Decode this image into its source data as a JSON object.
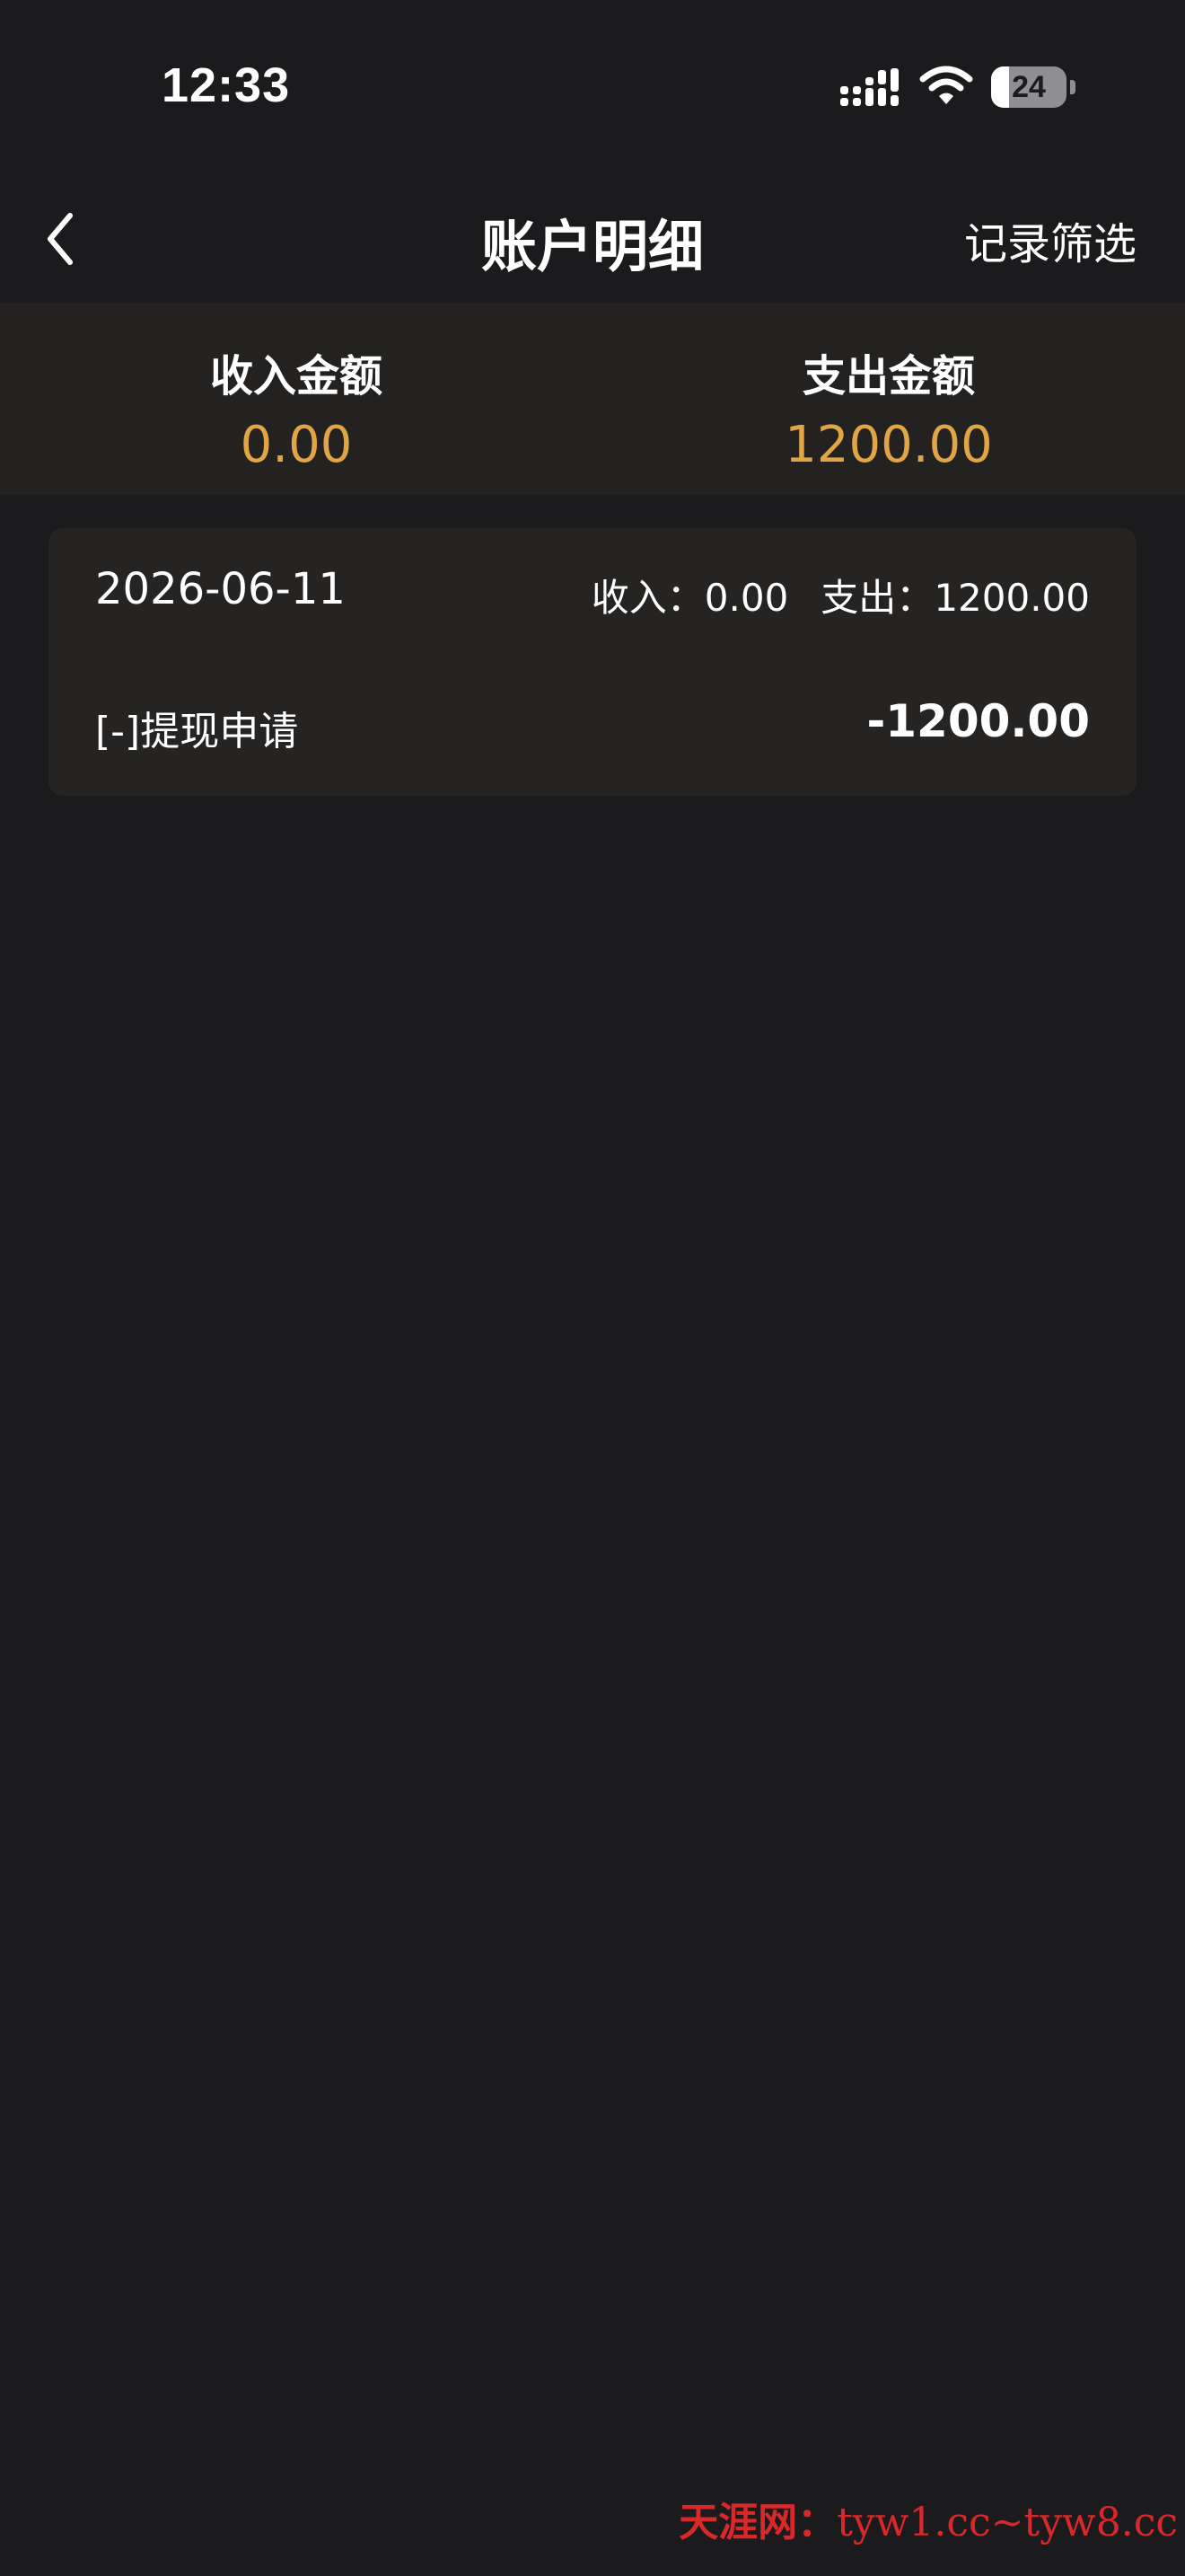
{
  "status_bar": {
    "time": "12:33",
    "battery_level": "24",
    "icons": [
      "signal-icon",
      "wifi-icon",
      "battery-icon"
    ]
  },
  "nav": {
    "back_icon": "chevron-left-icon",
    "title": "账户明细",
    "filter_label": "记录筛选"
  },
  "summary": {
    "income_label": "收入金额",
    "income_value": "0.00",
    "expense_label": "支出金额",
    "expense_value": "1200.00"
  },
  "records": [
    {
      "date": "2026-06-11",
      "income_label": "收入：",
      "income_value": "0.00",
      "expense_label": "支出：",
      "expense_value": "1200.00",
      "description": "[-]提现申请",
      "amount": "-1200.00"
    }
  ],
  "watermark": {
    "name": "天涯网：",
    "urls": "tyw1.cc~tyw8.cc"
  },
  "colors": {
    "background": "#1b1b1d",
    "summary_background": "#232221",
    "card_background": "#252423",
    "accent_amount": "#e0a545",
    "watermark": "#d8282a"
  }
}
